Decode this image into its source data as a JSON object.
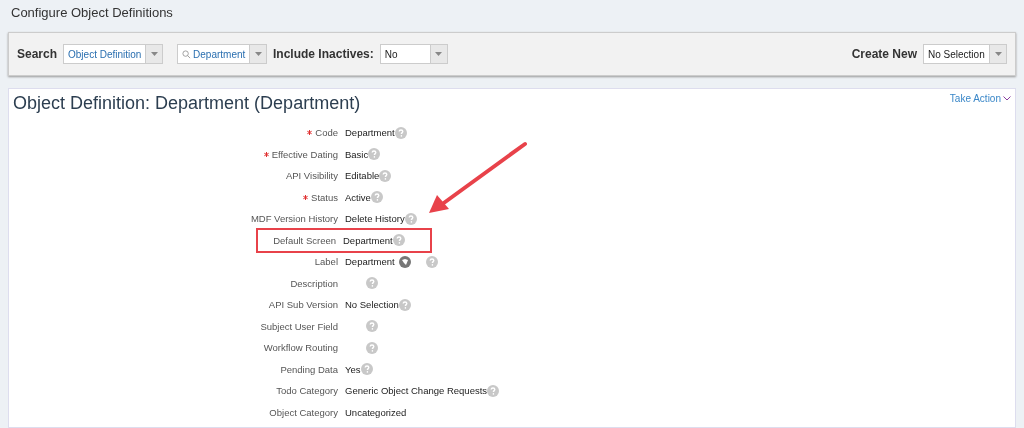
{
  "page_title": "Configure Object Definitions",
  "search_bar": {
    "search_label": "Search",
    "type_select": {
      "value": "Object Definition"
    },
    "object_search": {
      "value": "Department"
    },
    "inactives_label": "Include Inactives:",
    "inactives_select": {
      "value": "No"
    },
    "create_label": "Create New",
    "create_select": {
      "value": "No Selection"
    }
  },
  "detail": {
    "title": "Object Definition: Department (Department)",
    "take_action": "Take Action",
    "fields": [
      {
        "label": "Code",
        "required": true,
        "value": "Department",
        "help": true,
        "highlighted": false
      },
      {
        "label": "Effective Dating",
        "required": true,
        "value": "Basic",
        "help": true,
        "highlighted": false
      },
      {
        "label": "API Visibility",
        "required": false,
        "value": "Editable",
        "help": true,
        "highlighted": false
      },
      {
        "label": "Status",
        "required": true,
        "value": "Active",
        "help": true,
        "highlighted": false
      },
      {
        "label": "MDF Version History",
        "required": false,
        "value": "Delete History",
        "help": true,
        "highlighted": false
      },
      {
        "label": "Default Screen",
        "required": false,
        "value": "Department",
        "help": true,
        "highlighted": true
      },
      {
        "label": "Label",
        "required": false,
        "value": "Department",
        "translatable": true,
        "help": true,
        "highlighted": false
      },
      {
        "label": "Description",
        "required": false,
        "help": true,
        "highlighted": false
      },
      {
        "label": "API Sub Version",
        "required": false,
        "value": "No Selection",
        "help": true,
        "highlighted": false
      },
      {
        "label": "Subject User Field",
        "required": false,
        "help": true,
        "highlighted": false
      },
      {
        "label": "Workflow Routing",
        "required": false,
        "help": true,
        "highlighted": false
      },
      {
        "label": "Pending Data",
        "required": false,
        "value": "Yes",
        "help": true,
        "highlighted": false
      },
      {
        "label": "Todo Category",
        "required": false,
        "value": "Generic Object Change Requests",
        "help": true,
        "highlighted": false
      },
      {
        "label": "Object Category",
        "required": false,
        "value": "Uncategorized",
        "help": false,
        "highlighted": false
      }
    ]
  }
}
